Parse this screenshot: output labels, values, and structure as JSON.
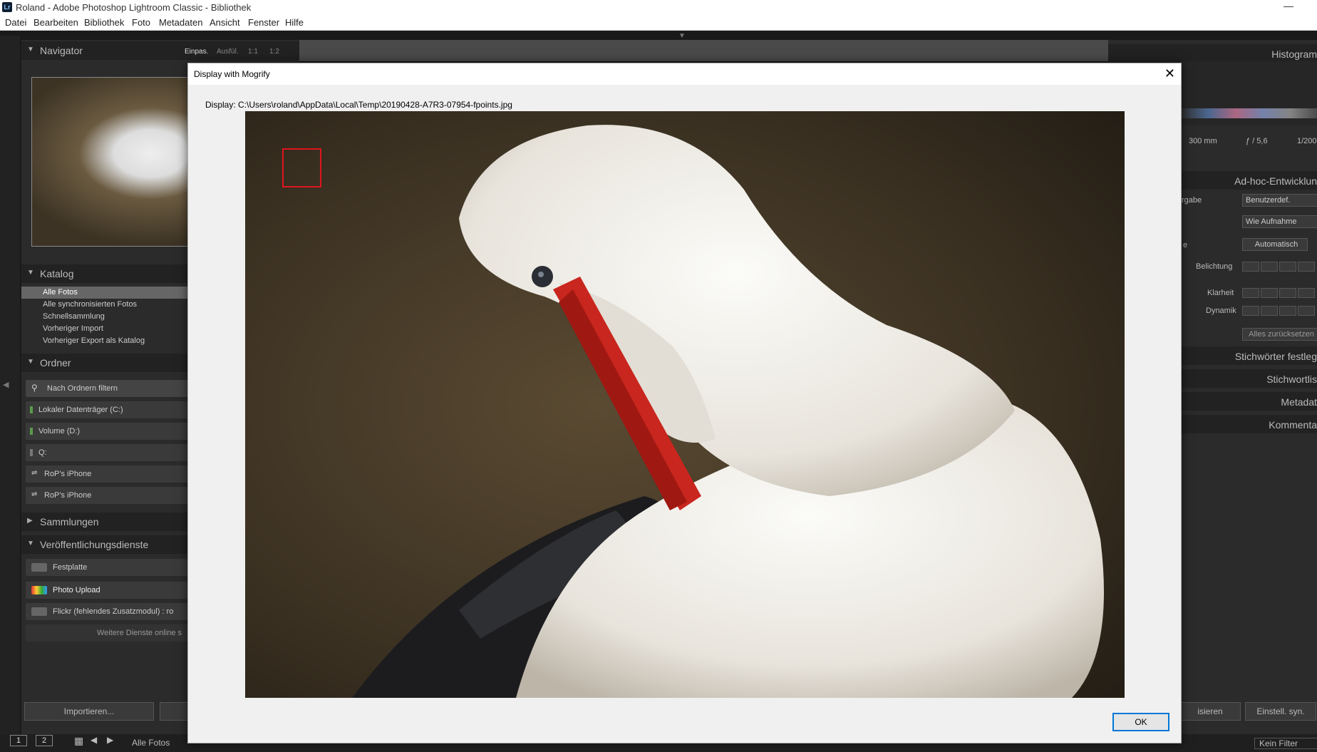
{
  "window": {
    "app_icon": "Lr",
    "title": "Roland - Adobe Photoshop Lightroom Classic - Bibliothek",
    "minimize_icon": "minimize-icon"
  },
  "menu": [
    "Datei",
    "Bearbeiten",
    "Bibliothek",
    "Foto",
    "Metadaten",
    "Ansicht",
    "Fenster",
    "Hilfe"
  ],
  "left_panel": {
    "navigator": {
      "label": "Navigator",
      "options": [
        "Einpas.",
        "Ausfül.",
        "1:1",
        "1:2"
      ]
    },
    "catalog": {
      "label": "Katalog",
      "items": [
        "Alle Fotos",
        "Alle synchronisierten Fotos",
        "Schnellsammlung",
        "Vorheriger Import",
        "Vorheriger Export als Katalog"
      ],
      "selected_index": 0
    },
    "folders": {
      "label": "Ordner",
      "filter_label": "Nach Ordnern filtern",
      "items": [
        "Lokaler Datenträger (C:)",
        "Volume (D:)",
        "Q:",
        "RoP's iPhone",
        "RoP's iPhone"
      ]
    },
    "collections": {
      "label": "Sammlungen"
    },
    "publish": {
      "label": "Veröffentlichungsdienste",
      "items": [
        "Festplatte",
        "Photo Upload",
        "Flickr (fehlendes Zusatzmodul) : ro",
        "Weitere Dienste online s"
      ]
    },
    "import_button": "Importieren..."
  },
  "right_panel": {
    "histogram": "Histogram",
    "exif": [
      "300 mm",
      "ƒ / 5,6",
      "1/200"
    ],
    "quick_develop": "Ad-hoc-Entwicklun",
    "preset_label": "rgabe",
    "preset_value": "Benutzerdef.",
    "wb_value": "Wie Aufnahme",
    "tone_label": "e",
    "auto_button": "Automatisch",
    "exposure": "Belichtung",
    "clarity": "Klarheit",
    "vibrance": "Dynamik",
    "reset_button": "Alles zurücksetzen",
    "keywording": "Stichwörter festleg",
    "keyword_list": "Stichwortlis",
    "metadata": "Metadat",
    "comments": "Kommenta",
    "sync_left": "isieren",
    "sync_button": "Einstell. syn."
  },
  "filmstrip": {
    "page1": "1",
    "page2": "2",
    "source": "Alle Fotos",
    "filter": "Kein Filter"
  },
  "dialog": {
    "title": "Display with Mogrify",
    "path": "Display: C:\\Users\\roland\\AppData\\Local\\Temp\\20190428-A7R3-07954-fpoints.jpg",
    "ok": "OK",
    "close_icon": "close-icon",
    "focus_marker_color": "#e0141e"
  }
}
